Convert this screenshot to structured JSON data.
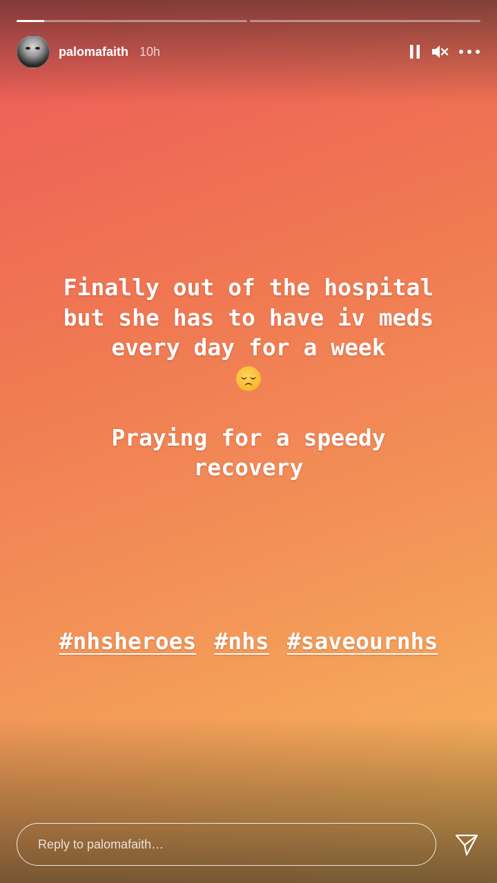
{
  "progress": {
    "segments": [
      {
        "filled_fraction": 0.12
      },
      {
        "filled_fraction": 0
      }
    ]
  },
  "header": {
    "username": "palomafaith",
    "time": "10h",
    "icons": [
      "pause-icon",
      "mute-icon",
      "more-options-icon"
    ]
  },
  "story": {
    "lines": [
      "Finally out of the hospital",
      "but she has to have iv meds",
      "every day for a week"
    ],
    "emoji": "pensive-face-emoji",
    "lines2": [
      "Praying for a speedy",
      "recovery"
    ],
    "hashtags": [
      "#nhsheroes",
      "#nhs",
      "#saveournhs"
    ]
  },
  "reply": {
    "placeholder": "Reply to palomafaith…"
  },
  "colors": {
    "gradient_start": "#ee5a5a",
    "gradient_mid": "#f39558",
    "gradient_end": "#f8bb5c",
    "text": "#ffffff"
  }
}
